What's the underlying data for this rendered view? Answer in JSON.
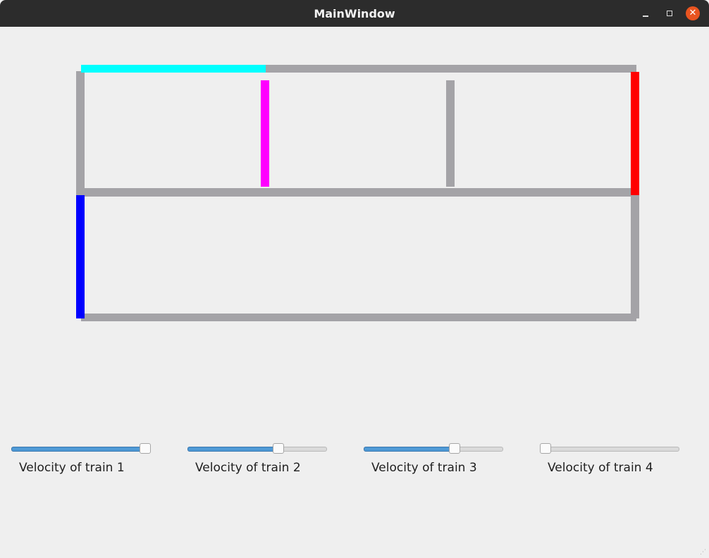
{
  "window": {
    "title": "MainWindow",
    "minimize_icon": "minimize-icon",
    "maximize_icon": "maximize-icon",
    "close_icon": "close-icon",
    "close_color": "#e95420"
  },
  "colors": {
    "track": "#a4a3a7",
    "train1": "#0000ff",
    "train2": "#ff0000",
    "train3": "#ff00ff",
    "train4": "#00ffff",
    "slider_fill": "#4f9ad6"
  },
  "sliders": [
    {
      "label": "Velocity of train 1",
      "value_fraction": 1.0
    },
    {
      "label": "Velocity of train 2",
      "value_fraction": 0.65
    },
    {
      "label": "Velocity of train 3",
      "value_fraction": 0.65
    },
    {
      "label": "Velocity of train 4",
      "value_fraction": 0.0
    }
  ]
}
